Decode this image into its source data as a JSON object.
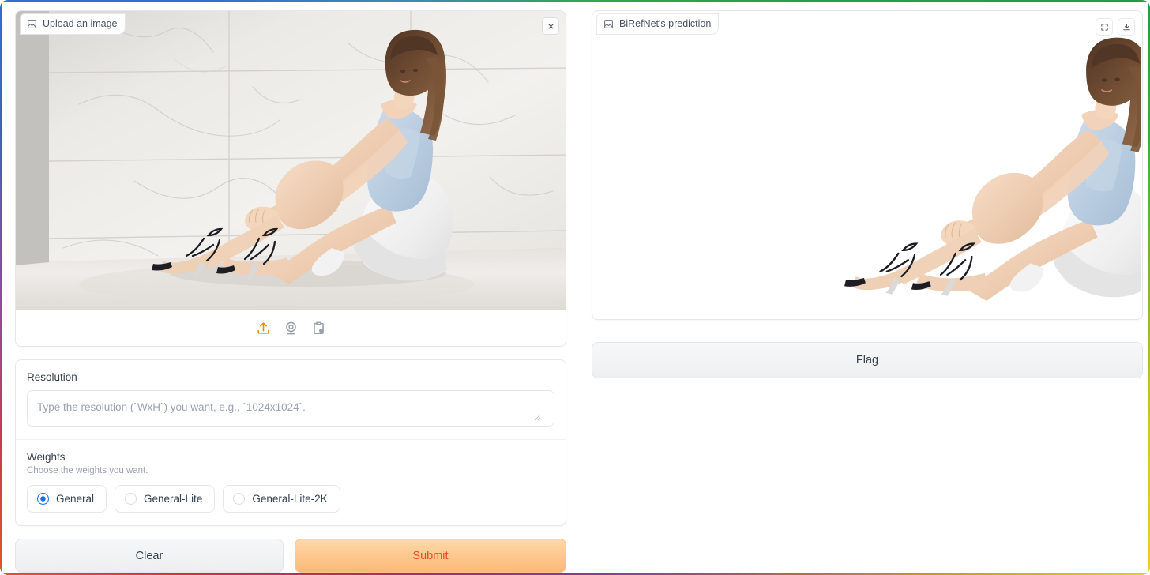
{
  "theme": {
    "accent_orange": "#f0870a",
    "submit_text_color": "#ef4a22",
    "radio_blue": "#1d6ef0",
    "border_gray": "#e5e7eb"
  },
  "input_panel": {
    "label": "Upload an image",
    "label_icon": "image-placeholder-icon",
    "close_icon": "close-icon",
    "toolbar": [
      {
        "name": "upload-icon",
        "title": "Upload"
      },
      {
        "name": "webcam-icon",
        "title": "Webcam"
      },
      {
        "name": "paste-clipboard-icon",
        "title": "Paste from clipboard"
      }
    ],
    "image_alt": "Seated young woman in light blue top and white skirt against marble tile wall"
  },
  "resolution": {
    "label": "Resolution",
    "value": "",
    "placeholder": "Type the resolution (`WxH`) you want, e.g., `1024x1024`."
  },
  "weights": {
    "label": "Weights",
    "info": "Choose the weights you want.",
    "selected": "General",
    "options": [
      {
        "label": "General",
        "checked": true
      },
      {
        "label": "General-Lite",
        "checked": false
      },
      {
        "label": "General-Lite-2K",
        "checked": false
      }
    ]
  },
  "actions": {
    "clear_label": "Clear",
    "submit_label": "Submit"
  },
  "output_panel": {
    "label": "BiRefNet's prediction",
    "label_icon": "image-placeholder-icon",
    "tools": [
      {
        "name": "fullscreen-icon",
        "title": "Fullscreen"
      },
      {
        "name": "download-icon",
        "title": "Download"
      }
    ],
    "image_alt": "Same subject with background removed on white",
    "flag_label": "Flag"
  }
}
